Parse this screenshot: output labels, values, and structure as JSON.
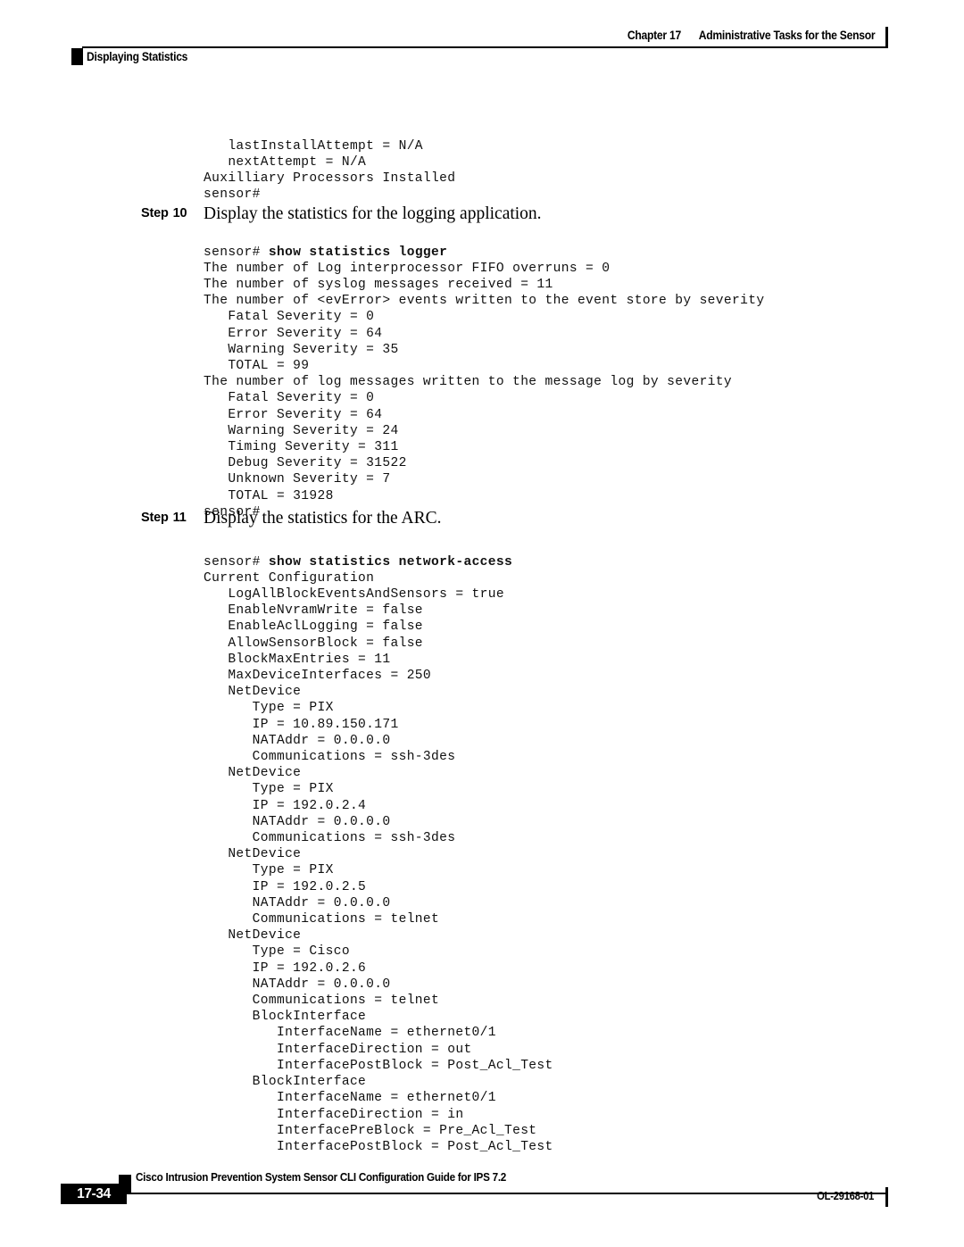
{
  "header": {
    "chapter_number": "Chapter 17",
    "chapter_title": "Administrative Tasks for the Sensor",
    "section_title": "Displaying Statistics"
  },
  "body": {
    "code_top": "   lastInstallAttempt = N/A\n   nextAttempt = N/A\nAuxilliary Processors Installed\nsensor#",
    "steps": [
      {
        "label_word": "Step",
        "label_number": "10",
        "text": "Display the statistics for the logging application.",
        "prompt": "sensor# ",
        "command": "show statistics logger",
        "output": "The number of Log interprocessor FIFO overruns = 0\nThe number of syslog messages received = 11\nThe number of <evError> events written to the event store by severity\n   Fatal Severity = 0\n   Error Severity = 64\n   Warning Severity = 35\n   TOTAL = 99\nThe number of log messages written to the message log by severity\n   Fatal Severity = 0\n   Error Severity = 64\n   Warning Severity = 24\n   Timing Severity = 311\n   Debug Severity = 31522\n   Unknown Severity = 7\n   TOTAL = 31928\nsensor#"
      },
      {
        "label_word": "Step",
        "label_number": "11",
        "text": "Display the statistics for the ARC.",
        "prompt": "sensor# ",
        "command": "show statistics network-access",
        "output": "Current Configuration\n   LogAllBlockEventsAndSensors = true\n   EnableNvramWrite = false\n   EnableAclLogging = false\n   AllowSensorBlock = false\n   BlockMaxEntries = 11\n   MaxDeviceInterfaces = 250\n   NetDevice\n      Type = PIX\n      IP = 10.89.150.171\n      NATAddr = 0.0.0.0\n      Communications = ssh-3des\n   NetDevice\n      Type = PIX\n      IP = 192.0.2.4\n      NATAddr = 0.0.0.0\n      Communications = ssh-3des\n   NetDevice\n      Type = PIX\n      IP = 192.0.2.5\n      NATAddr = 0.0.0.0\n      Communications = telnet\n   NetDevice\n      Type = Cisco\n      IP = 192.0.2.6\n      NATAddr = 0.0.0.0\n      Communications = telnet\n      BlockInterface\n         InterfaceName = ethernet0/1\n         InterfaceDirection = out\n         InterfacePostBlock = Post_Acl_Test\n      BlockInterface\n         InterfaceName = ethernet0/1\n         InterfaceDirection = in\n         InterfacePreBlock = Pre_Acl_Test\n         InterfacePostBlock = Post_Acl_Test"
      }
    ]
  },
  "footer": {
    "page_number": "17-34",
    "document_title": "Cisco Intrusion Prevention System Sensor CLI Configuration Guide for IPS 7.2",
    "document_id": "OL-29168-01"
  }
}
